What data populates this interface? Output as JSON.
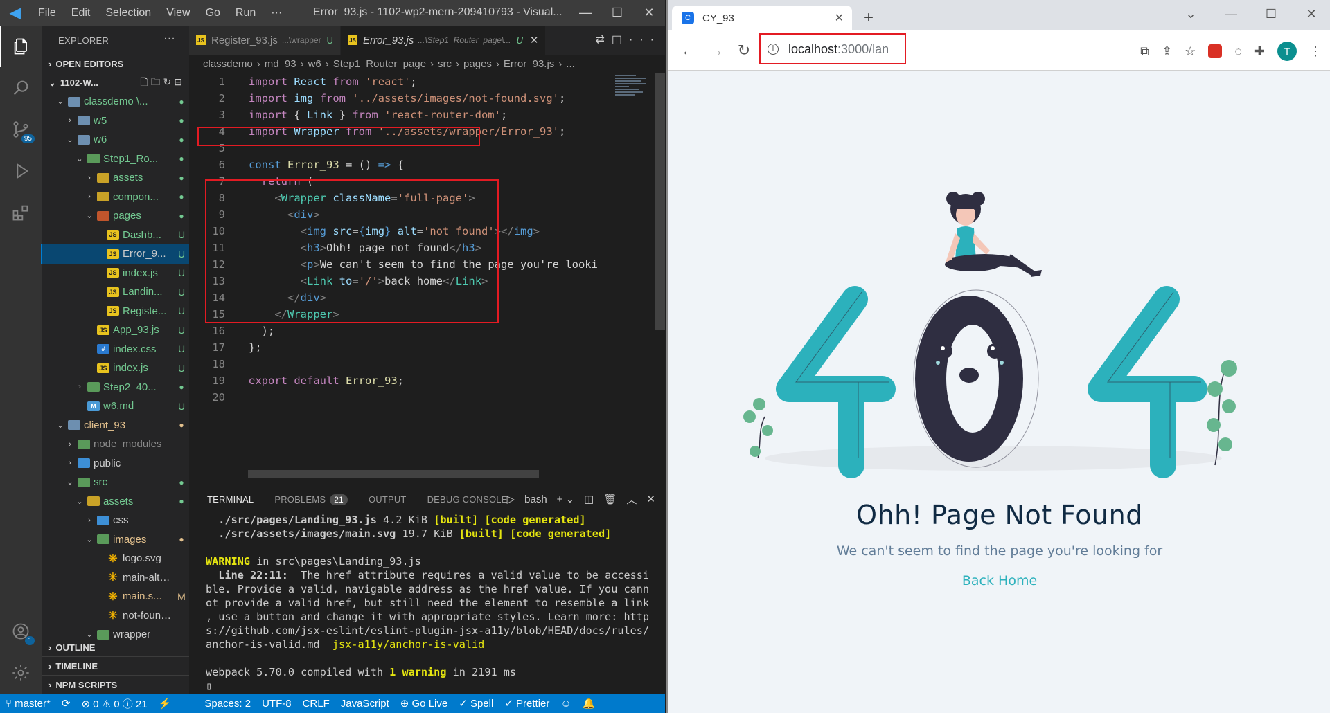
{
  "vscode": {
    "logo": "◀",
    "menu": [
      "File",
      "Edit",
      "Selection",
      "View",
      "Go",
      "Run",
      "···"
    ],
    "window_title": "Error_93.js - 1102-wp2-mern-209410793 - Visual...",
    "window_controls": [
      "—",
      "☐",
      "✕"
    ],
    "activity": {
      "source_control_badge": "95",
      "accounts_badge": "1"
    },
    "explorer": {
      "header": "EXPLORER",
      "dots": "···",
      "open_editors": "OPEN EDITORS",
      "workspace": "1102-W...",
      "tree": [
        {
          "label": "classdemo \\...",
          "kind": "folder",
          "depth": 1,
          "open": true,
          "status": "●",
          "git": true
        },
        {
          "label": "w5",
          "kind": "folder",
          "depth": 2,
          "open": false,
          "status": "●",
          "git": true
        },
        {
          "label": "w6",
          "kind": "folder",
          "depth": 2,
          "open": true,
          "status": "●",
          "git": true
        },
        {
          "label": "Step1_Ro...",
          "kind": "folder-g",
          "depth": 3,
          "open": true,
          "status": "●",
          "git": true
        },
        {
          "label": "assets",
          "kind": "folder-y",
          "depth": 4,
          "open": false,
          "status": "●",
          "git": true
        },
        {
          "label": "compon...",
          "kind": "folder-y",
          "depth": 4,
          "open": false,
          "status": "●",
          "git": true
        },
        {
          "label": "pages",
          "kind": "folder-r",
          "depth": 4,
          "open": true,
          "status": "●",
          "git": true
        },
        {
          "label": "Dashb...",
          "kind": "js",
          "depth": 5,
          "status": "U",
          "git": true
        },
        {
          "label": "Error_9...",
          "kind": "js",
          "depth": 5,
          "status": "U",
          "git": false,
          "selected": true
        },
        {
          "label": "index.js",
          "kind": "js",
          "depth": 5,
          "status": "U",
          "git": true
        },
        {
          "label": "Landin...",
          "kind": "js",
          "depth": 5,
          "status": "U",
          "git": true
        },
        {
          "label": "Registe...",
          "kind": "js",
          "depth": 5,
          "status": "U",
          "git": true
        },
        {
          "label": "App_93.js",
          "kind": "js",
          "depth": 4,
          "status": "U",
          "git": true
        },
        {
          "label": "index.css",
          "kind": "css",
          "depth": 4,
          "status": "U",
          "git": true
        },
        {
          "label": "index.js",
          "kind": "js",
          "depth": 4,
          "status": "U",
          "git": true
        },
        {
          "label": "Step2_40...",
          "kind": "folder-g",
          "depth": 3,
          "open": false,
          "status": "●",
          "git": true
        },
        {
          "label": "w6.md",
          "kind": "md",
          "depth": 3,
          "status": "U",
          "git": true
        },
        {
          "label": "client_93",
          "kind": "folder",
          "depth": 1,
          "open": true,
          "status": "●",
          "git": false,
          "mod": true
        },
        {
          "label": "node_modules",
          "kind": "folder-g",
          "depth": 2,
          "open": false,
          "status": "",
          "git": false,
          "dim": true
        },
        {
          "label": "public",
          "kind": "folder-b",
          "depth": 2,
          "open": false,
          "status": "",
          "git": false
        },
        {
          "label": "src",
          "kind": "folder-g",
          "depth": 2,
          "open": true,
          "status": "●",
          "git": true
        },
        {
          "label": "assets",
          "kind": "folder-y",
          "depth": 3,
          "open": true,
          "status": "●",
          "git": true
        },
        {
          "label": "css",
          "kind": "folder-b",
          "depth": 4,
          "open": false,
          "status": "",
          "git": false
        },
        {
          "label": "images",
          "kind": "folder-g",
          "depth": 4,
          "open": true,
          "status": "●",
          "git": true,
          "mod": true
        },
        {
          "label": "logo.svg",
          "kind": "svg",
          "depth": 5,
          "status": "",
          "git": false
        },
        {
          "label": "main-altern...",
          "kind": "svg",
          "depth": 5,
          "status": "",
          "git": false
        },
        {
          "label": "main.s...",
          "kind": "svg",
          "depth": 5,
          "status": "M",
          "git": false,
          "mod": true
        },
        {
          "label": "not-found.svg",
          "kind": "svg",
          "depth": 5,
          "status": "",
          "git": false
        },
        {
          "label": "wrapper",
          "kind": "folder-g",
          "depth": 4,
          "open": true,
          "status": "",
          "git": false
        }
      ],
      "outline": "OUTLINE",
      "timeline": "TIMELINE",
      "npm_scripts": "NPM SCRIPTS"
    },
    "tabs": [
      {
        "label": "Register_93.js",
        "sub": "...\\wrapper",
        "status": "U"
      },
      {
        "label": "Error_93.js",
        "sub": "...\\Step1_Router_page\\...",
        "status": "U",
        "close": "✕"
      }
    ],
    "breadcrumb": [
      "classdemo",
      "md_93",
      "w6",
      "Step1_Router_page",
      "src",
      "pages",
      "Error_93.js",
      "..."
    ],
    "code_lines": [
      {
        "n": "1",
        "html": "<span class='kw2'>import</span> <span class='vr'>React</span> <span class='kw2'>from</span> <span class='str'>'react'</span>;"
      },
      {
        "n": "2",
        "html": "<span class='kw2'>import</span> <span class='vr'>img</span> <span class='kw2'>from</span> <span class='str'>'../assets/images/not-found.svg'</span>;"
      },
      {
        "n": "3",
        "html": "<span class='kw2'>import</span> { <span class='vr'>Link</span> } <span class='kw2'>from</span> <span class='str'>'react-router-dom'</span>;"
      },
      {
        "n": "4",
        "html": "<span class='kw2'>import</span> <span class='vr'>Wrapper</span> <span class='kw2'>from</span> <span class='str'>'../assets/wrapper/Error_93'</span>;"
      },
      {
        "n": "5",
        "html": ""
      },
      {
        "n": "6",
        "html": "<span class='kw'>const</span> <span class='fn'>Error_93</span> = () <span class='kw'>=&gt;</span> {"
      },
      {
        "n": "7",
        "html": "  <span class='kw2'>return</span> ("
      },
      {
        "n": "8",
        "html": "    <span class='tgb'>&lt;</span><span class='tg'>Wrapper</span> <span class='at'>className</span>=<span class='str'>'full-page'</span><span class='tgb'>&gt;</span>"
      },
      {
        "n": "9",
        "html": "      <span class='tgb'>&lt;</span><span class='kw'>div</span><span class='tgb'>&gt;</span>"
      },
      {
        "n": "10",
        "html": "        <span class='tgb'>&lt;</span><span class='kw'>img</span> <span class='at'>src</span>=<span class='kw'>{</span><span class='vr'>img</span><span class='kw'>}</span> <span class='at'>alt</span>=<span class='str'>'not found'</span><span class='tgb'>&gt;&lt;/</span><span class='kw'>img</span><span class='tgb'>&gt;</span>"
      },
      {
        "n": "11",
        "html": "        <span class='tgb'>&lt;</span><span class='kw'>h3</span><span class='tgb'>&gt;</span>Ohh! page not found<span class='tgb'>&lt;/</span><span class='kw'>h3</span><span class='tgb'>&gt;</span>"
      },
      {
        "n": "12",
        "html": "        <span class='tgb'>&lt;</span><span class='kw'>p</span><span class='tgb'>&gt;</span>We can't seem to find the page you're looki"
      },
      {
        "n": "13",
        "html": "        <span class='tgb'>&lt;</span><span class='tg'>Link</span> <span class='at'>to</span>=<span class='str'>'/'</span><span class='tgb'>&gt;</span>back home<span class='tgb'>&lt;/</span><span class='tg'>Link</span><span class='tgb'>&gt;</span>"
      },
      {
        "n": "14",
        "html": "      <span class='tgb'>&lt;/</span><span class='kw'>div</span><span class='tgb'>&gt;</span>"
      },
      {
        "n": "15",
        "html": "    <span class='tgb'>&lt;/</span><span class='tg'>Wrapper</span><span class='tgb'>&gt;</span>"
      },
      {
        "n": "16",
        "html": "  );"
      },
      {
        "n": "17",
        "html": "};"
      },
      {
        "n": "18",
        "html": ""
      },
      {
        "n": "19",
        "html": "<span class='kw2'>export</span> <span class='kw2'>default</span> <span class='fn'>Error_93</span>;"
      },
      {
        "n": "20",
        "html": ""
      }
    ],
    "panel": {
      "tabs": [
        "TERMINAL",
        "PROBLEMS",
        "OUTPUT",
        "DEBUG CONSOLE"
      ],
      "problems_count": "21",
      "shell": "bash",
      "terminal_html": "  <span class='b'>./src/pages/Landing_93.js</span> 4.2 KiB <span class='y b'>[built]</span> <span class='y b'>[code generated]</span>\n  <span class='b'>./src/assets/images/main.svg</span> 19.7 KiB <span class='y b'>[built]</span> <span class='y b'>[code generated]</span>\n\n<span class='y b'>WARNING</span> in src\\pages\\Landing_93.js\n  <span class='b'>Line 22:11:</span>  The href attribute requires a valid value to be accessi\nble. Provide a valid, navigable address as the href value. If you cann\not provide a valid href, but still need the element to resemble a link\n, use a button and change it with appropriate styles. Learn more: http\ns://github.com/jsx-eslint/eslint-plugin-jsx-a11y/blob/HEAD/docs/rules/\nanchor-is-valid.md  <span class='ul'>jsx-a11y/anchor-is-valid</span>\n\nwebpack 5.70.0 compiled with <span class='y b'>1 warning</span> in 2191 ms\n▯"
    },
    "statusbar": [
      "⑂ master*",
      "⟳",
      "⊗ 0 ⚠ 0 ⓘ 21",
      "⚡",
      "Spaces: 2",
      "UTF-8",
      "CRLF",
      "JavaScript",
      "⊕ Go Live",
      "✓ Spell",
      "✓ Prettier",
      "☺",
      "🔔"
    ]
  },
  "chrome": {
    "tab_title": "CY_93",
    "tab_favicon": "C",
    "tab_close": "✕",
    "new_tab": "+",
    "window_controls": [
      "⌄",
      "—",
      "☐",
      "✕"
    ],
    "nav": [
      "←",
      "→",
      "↻"
    ],
    "url_host": "localhost",
    "url_path": ":3000/lan",
    "avatar": "T",
    "toolbar_icons": [
      "⧉",
      "⇪",
      "☆"
    ],
    "page": {
      "digits": [
        "4",
        "0",
        "4"
      ],
      "title": "Ohh! Page Not Found",
      "subtitle": "We can't seem to find the page you're looking for",
      "link": "Back Home",
      "colors": {
        "teal": "#2cb1bc",
        "dark": "#2f2e41",
        "title": "#102a43",
        "sub": "#627d98"
      }
    }
  }
}
